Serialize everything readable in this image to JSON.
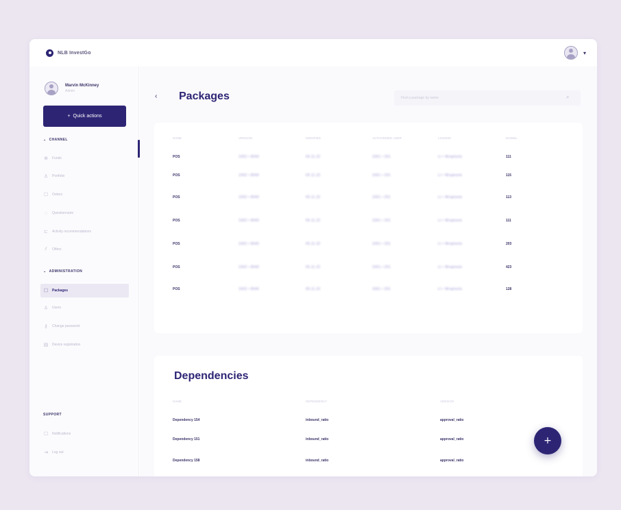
{
  "header": {
    "brand_name": "NLB InvestGo"
  },
  "user": {
    "name": "Marvin McKinney",
    "role": "Admin"
  },
  "sidebar": {
    "quick_actions": "Quick actions",
    "quick_actions_icon": "+",
    "section_channel": "CHANNEL",
    "channel_items": [
      {
        "label": "Funds",
        "icon": "funds-icon"
      },
      {
        "label": "Portfolio",
        "icon": "portfolio-icon"
      },
      {
        "label": "Orders",
        "icon": "orders-icon"
      },
      {
        "label": "Questionnaire",
        "icon": "questionnaire-icon"
      },
      {
        "label": "Activity recommendations",
        "icon": "activity-icon"
      },
      {
        "label": "Offers",
        "icon": "offers-icon"
      }
    ],
    "section_admin": "ADMINISTRATION",
    "admin_items": [
      {
        "label": "Packages",
        "icon": "packages-icon"
      },
      {
        "label": "Users",
        "icon": "users-icon"
      },
      {
        "label": "Change password",
        "icon": "key-icon"
      },
      {
        "label": "Device registration",
        "icon": "device-icon"
      }
    ],
    "section_support": "SUPPORT",
    "support_items": [
      {
        "label": "Notifications",
        "icon": "bell-icon"
      },
      {
        "label": "Log out",
        "icon": "logout-icon"
      }
    ]
  },
  "main": {
    "title": "Packages",
    "search_placeholder": "Find a package by name",
    "packages": {
      "columns": [
        "NAME",
        "VERSION",
        "MODIFIED",
        "AUTHORIZED USER",
        "LICENSE",
        "DOWNL."
      ],
      "rows": [
        [
          "POS",
          "1002 • 8040",
          "05.11.22",
          "1001 • 201",
          "LI • Wraptools",
          "111"
        ],
        [
          "POS",
          "1002 • 8040",
          "05.11.22",
          "1001 • 201",
          "LI • Wraptools",
          "115"
        ],
        [
          "POS",
          "1002 • 8040",
          "05.11.22",
          "1001 • 201",
          "LI • Wraptools",
          "113"
        ],
        [
          "POS",
          "1002 • 8040",
          "05.11.22",
          "1001 • 201",
          "LI • Wraptools",
          "111"
        ],
        [
          "POS",
          "1002 • 8040",
          "05.11.22",
          "1001 • 201",
          "LI • Wraptools",
          "203"
        ],
        [
          "POS",
          "1002 • 8040",
          "05.11.22",
          "1001 • 201",
          "LI • Wraptools",
          "423"
        ],
        [
          "POS",
          "1002 • 8040",
          "05.11.22",
          "1001 • 201",
          "LI • Wraptools",
          "128"
        ]
      ]
    },
    "dependencies": {
      "title": "Dependencies",
      "columns": [
        "NAME",
        "DEPENDENCY",
        "VERSION"
      ],
      "rows": [
        [
          "Dependency 154",
          "inbound_ratio",
          "approval_ratio"
        ],
        [
          "Dependency 151",
          "inbound_ratio",
          "approval_ratio"
        ],
        [
          "Dependency 158",
          "inbound_ratio",
          "approval_ratio"
        ]
      ]
    },
    "fab_icon": "+"
  },
  "colors": {
    "accent": "#2d2574",
    "background": "#ece6f1",
    "muted": "#bcb8cd"
  }
}
